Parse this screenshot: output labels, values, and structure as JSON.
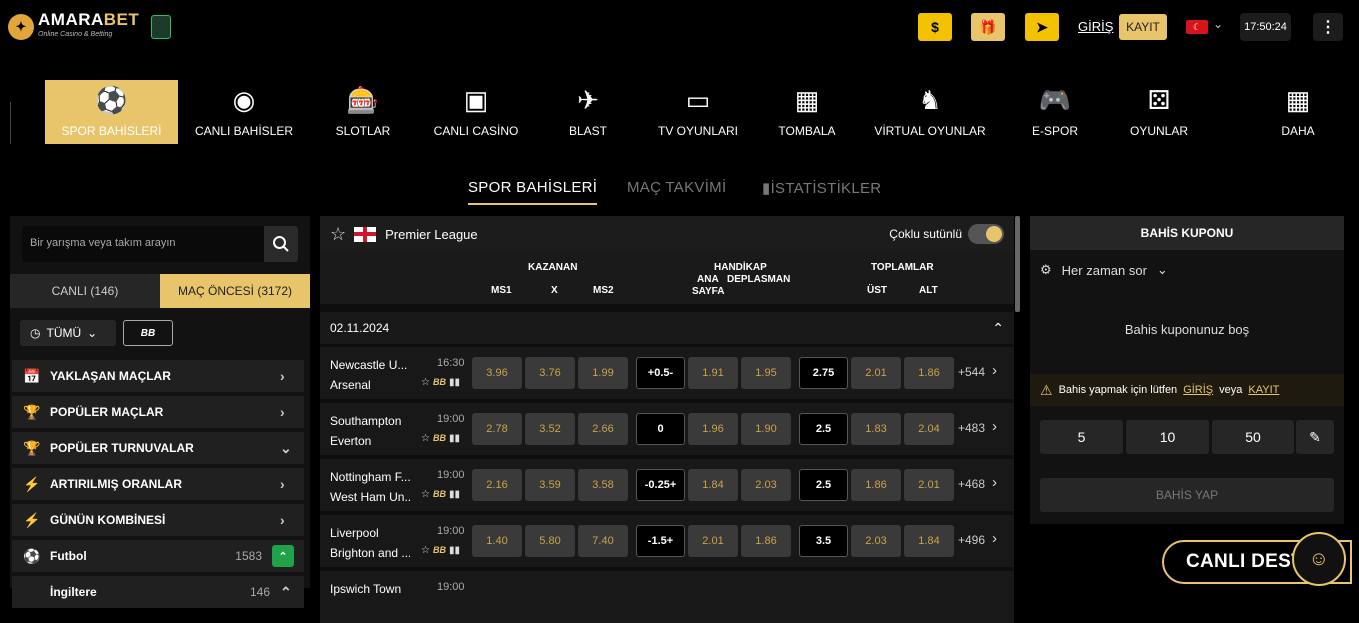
{
  "brand": {
    "name_main": "AMARA",
    "name_accent": "BET",
    "tagline": "Online Casino & Betting"
  },
  "top": {
    "login": "GİRİŞ",
    "register": "KAYIT",
    "time": "17:50:24",
    "lang_flag": "TR"
  },
  "nav": [
    {
      "label": "SPOR BAHİSLERİ",
      "icon": "soccer-ball-icon",
      "glyph": "⚽"
    },
    {
      "label": "CANLI BAHİSLER",
      "icon": "live-icon",
      "glyph": "◉"
    },
    {
      "label": "SLOTLAR",
      "icon": "slot-icon",
      "glyph": "🎰"
    },
    {
      "label": "CANLI CASİNO",
      "icon": "live-casino-icon",
      "glyph": "▣"
    },
    {
      "label": "BLAST",
      "icon": "blast-icon",
      "glyph": "✈"
    },
    {
      "label": "TV OYUNLARI",
      "icon": "tv-icon",
      "glyph": "▭"
    },
    {
      "label": "TOMBALA",
      "icon": "tombala-icon",
      "glyph": "▦"
    },
    {
      "label": "VİRTUAL OYUNLAR",
      "icon": "virtual-icon",
      "glyph": "♞"
    },
    {
      "label": "E-SPOR",
      "icon": "gamepad-icon",
      "glyph": "🎮"
    },
    {
      "label": "OYUNLAR",
      "icon": "dice-icon",
      "glyph": "⚄"
    },
    {
      "label": "DAHA",
      "icon": "grid-icon",
      "glyph": "▦"
    }
  ],
  "subnav": {
    "tab1": "SPOR BAHİSLERİ",
    "tab2": "MAÇ TAKVİMİ",
    "tab3": "İSTATİSTİKLER"
  },
  "left": {
    "search_placeholder": "Bir yarışma veya takım arayın",
    "tab_live": "CANLI (146)",
    "tab_pre": "MAÇ ÖNCESİ (3172)",
    "filter": "TÜMÜ",
    "bb": "BB",
    "rows": [
      {
        "label": "YAKLAŞAN MAÇLAR",
        "glyph": "📅"
      },
      {
        "label": "POPÜLER MAÇLAR",
        "glyph": "🏆"
      },
      {
        "label": "POPÜLER TURNUVALAR",
        "glyph": "🏆"
      },
      {
        "label": "ARTIRILMIŞ ORANLAR",
        "glyph": "⚡"
      },
      {
        "label": "GÜNÜN KOMBİNESİ",
        "glyph": "⚡"
      },
      {
        "label": "Futbol",
        "glyph": "⚽",
        "count": "1583"
      },
      {
        "label": "İngiltere",
        "glyph": "",
        "count": "146"
      }
    ]
  },
  "mid": {
    "league": "Premier League",
    "multi_col": "Çoklu sutünlü",
    "headers": {
      "winner": "KAZANAN",
      "ms1": "MS1",
      "x": "X",
      "ms2": "MS2",
      "handicap": "HANDİKAP",
      "ana": "ANA",
      "dep": "DEPLASMAN",
      "sayfa": "SAYFA",
      "totals": "TOPLAMLAR",
      "ust": "ÜST",
      "alt": "ALT"
    },
    "date": "02.11.2024",
    "matches": [
      {
        "home": "Newcastle U...",
        "away": "Arsenal",
        "time": "16:30",
        "o1": "3.96",
        "ox": "3.76",
        "o2": "1.99",
        "hv": "+0.5-",
        "h1": "1.91",
        "h2": "1.95",
        "tv": "2.75",
        "t1": "2.01",
        "t2": "1.86",
        "more": "+544"
      },
      {
        "home": "Southampton",
        "away": "Everton",
        "time": "19:00",
        "o1": "2.78",
        "ox": "3.52",
        "o2": "2.66",
        "hv": "0",
        "h1": "1.96",
        "h2": "1.90",
        "tv": "2.5",
        "t1": "1.83",
        "t2": "2.04",
        "more": "+483"
      },
      {
        "home": "Nottingham F...",
        "away": "West Ham Un...",
        "time": "19:00",
        "o1": "2.16",
        "ox": "3.59",
        "o2": "3.58",
        "hv": "-0.25+",
        "h1": "1.84",
        "h2": "2.03",
        "tv": "2.5",
        "t1": "1.86",
        "t2": "2.01",
        "more": "+468"
      },
      {
        "home": "Liverpool",
        "away": "Brighton and ...",
        "time": "19:00",
        "o1": "1.40",
        "ox": "5.80",
        "o2": "7.40",
        "hv": "-1.5+",
        "h1": "2.01",
        "h2": "1.86",
        "tv": "3.5",
        "t1": "2.03",
        "t2": "1.84",
        "more": "+496"
      },
      {
        "home": "Ipswich Town",
        "away": "",
        "time": "19:00",
        "o1": "",
        "ox": "",
        "o2": "",
        "hv": "",
        "h1": "",
        "h2": "",
        "tv": "",
        "t1": "",
        "t2": "",
        "more": ""
      }
    ]
  },
  "right": {
    "title": "BAHİS KUPONU",
    "setting": "Her zaman sor",
    "empty": "Bahis kuponunuz boş",
    "warn_a": "Bahis yapmak için lütfen",
    "warn_login": "GİRİŞ",
    "warn_or": "veya",
    "warn_reg": "KAYIT",
    "stakes": [
      "5",
      "10",
      "50"
    ],
    "place": "BAHİS YAP"
  },
  "support": "CANLI DESTEK"
}
